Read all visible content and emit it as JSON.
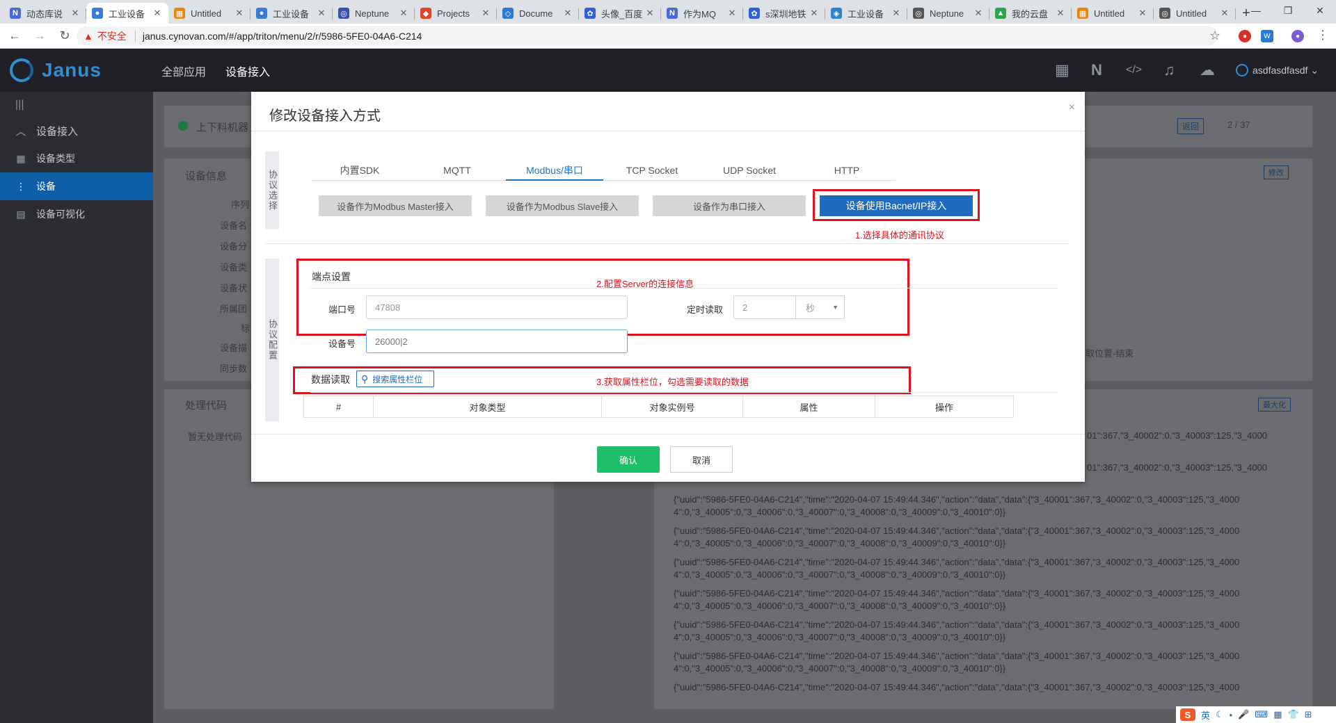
{
  "browser": {
    "tabs": [
      {
        "label": "动态库说",
        "icon": "N",
        "color": "#4a6bd6"
      },
      {
        "label": "工业设备",
        "icon": "●",
        "color": "#3a7bd5",
        "active": true
      },
      {
        "label": "Untitled",
        "icon": "▦",
        "color": "#e8850c"
      },
      {
        "label": "工业设备",
        "icon": "●",
        "color": "#3a7bd5"
      },
      {
        "label": "Neptune",
        "icon": "◎",
        "color": "#3b4fa8"
      },
      {
        "label": "Projects",
        "icon": "◆",
        "color": "#e24329"
      },
      {
        "label": "Docume",
        "icon": "◇",
        "color": "#2b7ad4"
      },
      {
        "label": "头像_百度",
        "icon": "✿",
        "color": "#2f5fd9"
      },
      {
        "label": "作为MQ",
        "icon": "N",
        "color": "#4a6bd6"
      },
      {
        "label": "s深圳地铁",
        "icon": "✿",
        "color": "#2f5fd9"
      },
      {
        "label": "工业设备",
        "icon": "◈",
        "color": "#2d86c9"
      },
      {
        "label": "Neptune",
        "icon": "◎",
        "color": "#555555"
      },
      {
        "label": "我的云盘",
        "icon": "▲",
        "color": "#2ea44f"
      },
      {
        "label": "Untitled",
        "icon": "▦",
        "color": "#e8850c"
      },
      {
        "label": "Untitled",
        "icon": "◎",
        "color": "#555555"
      }
    ],
    "address": {
      "warning": "▲",
      "insecure_label": "不安全",
      "url": "janus.cynovan.com/#/app/triton/menu/2/r/5986-5FE0-04A6-C214"
    }
  },
  "header": {
    "logo_text": "Janus",
    "nav": [
      {
        "label": "全部应用"
      },
      {
        "label": "设备接入",
        "active": true
      }
    ],
    "username": "asdfasdfasdf"
  },
  "sidebar": {
    "items": [
      {
        "label": "设备接入",
        "icon": "▲",
        "group": true
      },
      {
        "label": "设备类型",
        "icon": "▦"
      },
      {
        "label": "设备",
        "icon": "⋮",
        "active": true
      },
      {
        "label": "设备可视化",
        "icon": "▤"
      }
    ]
  },
  "background": {
    "device_name": "上下料机器",
    "card_title": "设备信息",
    "back_button": "返回",
    "pager": "2 / 37",
    "edit_button": "修改",
    "code_title": "处理代码",
    "code_empty": "暂无处理代码",
    "maximize_button": "最大化",
    "tail_text": "取位置-结束",
    "field_labels": [
      "序列",
      "设备名",
      "设备分",
      "设备类",
      "设备状",
      "所属团",
      "标",
      "设备描",
      "同步数"
    ],
    "log_line_1": "{\"uuid\":\"5986-5FE0-04A6-C214\",\"time\":\"2020-04-07 15:49:44.346\",\"action\":\"data\",\"data\":{\"3_40001\":367,\"3_40002\":0,\"3_40003\":125,\"3_4000",
    "log_line_2": "4\":0,\"3_40005\":0,\"3_40006\":0,\"3_40007\":0,\"3_40008\":0,\"3_40009\":0,\"3_40010\":0}}",
    "log_partial": "01\":367,\"3_40002\":0,\"3_40003\":125,\"3_4000"
  },
  "modal": {
    "title": "修改设备接入方式",
    "close": "×",
    "protocol_label": "协议选择",
    "config_label": "协议配置",
    "protocol_tabs": [
      {
        "label": "内置SDK"
      },
      {
        "label": "MQTT"
      },
      {
        "label": "Modbus/串口",
        "active": true
      },
      {
        "label": "TCP Socket"
      },
      {
        "label": "UDP Socket"
      },
      {
        "label": "HTTP"
      }
    ],
    "sub_buttons": [
      {
        "label": "设备作为Modbus Master接入"
      },
      {
        "label": "设备作为Modbus Slave接入"
      },
      {
        "label": "设备作为串口接入"
      },
      {
        "label": "设备使用Bacnet/IP接入",
        "primary": true
      }
    ],
    "annotation_1": "1.选择具体的通讯协议",
    "annotation_2": "2.配置Server的连接信息",
    "annotation_3": "3.获取属性栏位，勾选需要读取的数据",
    "endpoint_title": "端点设置",
    "port_label": "端口号",
    "port_value": "47808",
    "device_no_label": "设备号",
    "device_no_value": "26000|2",
    "timer_label": "定时读取",
    "timer_value": "2",
    "timer_unit": "秒",
    "data_read_title": "数据读取",
    "search_button": "搜索属性栏位",
    "table_headers": [
      "#",
      "对象类型",
      "对象实例号",
      "属性",
      "操作"
    ],
    "ok_button": "确认",
    "cancel_button": "取消"
  },
  "tray": {
    "ime": "S",
    "lang": "英"
  },
  "colors": {
    "accent": "#1f6cbf",
    "ok_green": "#1fbf6a",
    "annotation_red": "#e0101c",
    "header_bg": "#1f2126"
  }
}
